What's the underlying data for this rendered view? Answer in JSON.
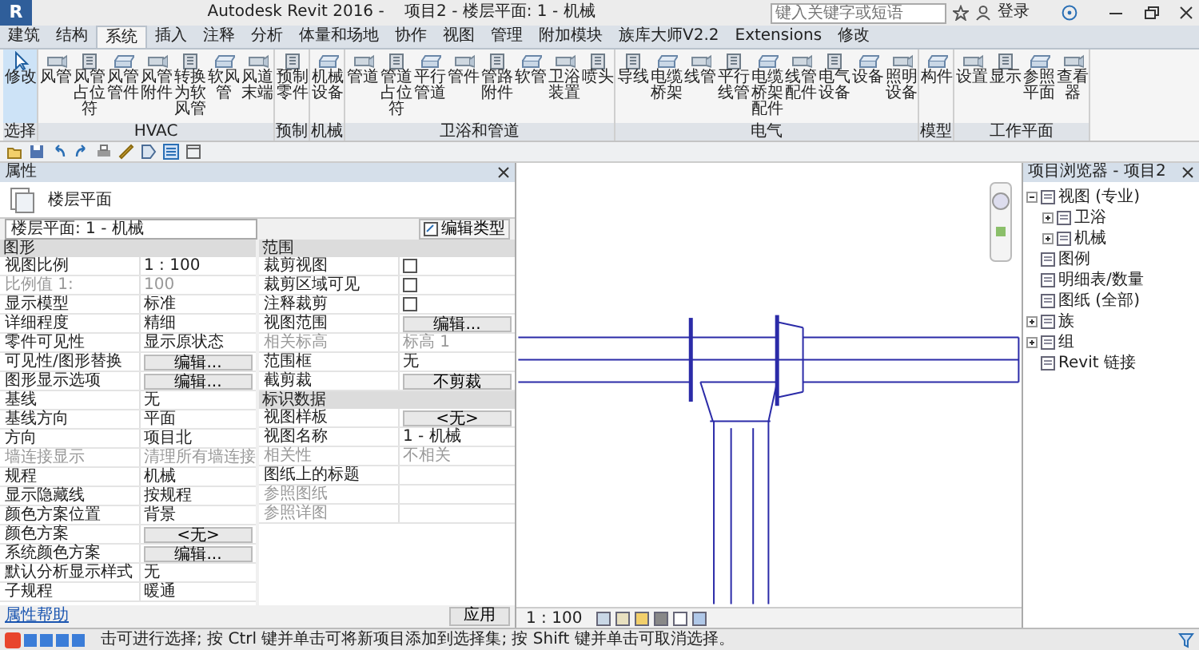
{
  "window": {
    "app_button": "R",
    "title": "Autodesk Revit 2016 -    项目2 - 楼层平面: 1 - 机械",
    "search": {
      "placeholder": "键入关键字或短语"
    },
    "sign_in": "登录"
  },
  "tabs": [
    {
      "label": "建筑",
      "selected": false
    },
    {
      "label": "结构",
      "selected": false
    },
    {
      "label": "系统",
      "selected": true
    },
    {
      "label": "插入",
      "selected": false
    },
    {
      "label": "注释",
      "selected": false
    },
    {
      "label": "分析",
      "selected": false
    },
    {
      "label": "体量和场地",
      "selected": false
    },
    {
      "label": "协作",
      "selected": false
    },
    {
      "label": "视图",
      "selected": false
    },
    {
      "label": "管理",
      "selected": false
    },
    {
      "label": "附加模块",
      "selected": false
    },
    {
      "label": "族库大师V2.2",
      "selected": false
    },
    {
      "label": "Extensions",
      "selected": false
    },
    {
      "label": "修改",
      "selected": false
    }
  ],
  "ribbon": {
    "panels": [
      {
        "label": "选择",
        "buttons": [
          "修改"
        ]
      },
      {
        "label": "HVAC",
        "buttons": [
          "风管",
          "风管占位符",
          "风管管件",
          "风管附件",
          "转换为软风管",
          "软风管",
          "风道末端"
        ]
      },
      {
        "label": "预制",
        "buttons": [
          "预制零件"
        ]
      },
      {
        "label": "机械",
        "buttons": [
          "机械设备"
        ]
      },
      {
        "label": "卫浴和管道",
        "buttons": [
          "管道",
          "管道占位符",
          "平行管道",
          "管件",
          "管路附件",
          "软管",
          "卫浴装置",
          "喷头"
        ]
      },
      {
        "label": "电气",
        "buttons": [
          "导线",
          "电缆桥架",
          "线管",
          "平行线管",
          "电缆桥架配件",
          "线管配件",
          "电气设备",
          "设备",
          "照明设备"
        ]
      },
      {
        "label": "模型",
        "buttons": [
          "构件"
        ]
      },
      {
        "label": "工作平面",
        "buttons": [
          "设置",
          "显示",
          "参照平面",
          "查看器"
        ]
      }
    ]
  },
  "properties": {
    "title": "属性",
    "type_name": "楼层平面",
    "instance": "楼层平面: 1 - 机械",
    "edit_type": "编辑类型",
    "groups": [
      {
        "name": "图形",
        "rows": [
          {
            "label": "视图比例",
            "kind": "text",
            "value": "1 : 100",
            "disabled": false
          },
          {
            "label": "比例值 1:",
            "kind": "text",
            "value": "100",
            "disabled": true
          },
          {
            "label": "显示模型",
            "kind": "text",
            "value": "标准",
            "disabled": false
          },
          {
            "label": "详细程度",
            "kind": "text",
            "value": "精细",
            "disabled": false
          },
          {
            "label": "零件可见性",
            "kind": "text",
            "value": "显示原状态",
            "disabled": false
          },
          {
            "label": "可见性/图形替换",
            "kind": "button",
            "value": "编辑...",
            "disabled": false
          },
          {
            "label": "图形显示选项",
            "kind": "button",
            "value": "编辑...",
            "disabled": false
          },
          {
            "label": "基线",
            "kind": "text",
            "value": "无",
            "disabled": false
          },
          {
            "label": "基线方向",
            "kind": "text",
            "value": "平面",
            "disabled": false
          },
          {
            "label": "方向",
            "kind": "text",
            "value": "项目北",
            "disabled": false
          },
          {
            "label": "墙连接显示",
            "kind": "text",
            "value": "清理所有墙连接",
            "disabled": true
          },
          {
            "label": "规程",
            "kind": "text",
            "value": "机械",
            "disabled": false
          },
          {
            "label": "显示隐藏线",
            "kind": "text",
            "value": "按规程",
            "disabled": false
          },
          {
            "label": "颜色方案位置",
            "kind": "text",
            "value": "背景",
            "disabled": false
          },
          {
            "label": "颜色方案",
            "kind": "button",
            "value": "<无>",
            "disabled": false
          },
          {
            "label": "系统颜色方案",
            "kind": "button",
            "value": "编辑...",
            "disabled": false
          },
          {
            "label": "默认分析显示样式",
            "kind": "text",
            "value": "无",
            "disabled": false
          },
          {
            "label": "子规程",
            "kind": "text",
            "value": "暖通",
            "disabled": false
          }
        ]
      },
      {
        "name": "范围",
        "rows": [
          {
            "label": "裁剪视图",
            "kind": "checkbox",
            "checked": false,
            "disabled": false
          },
          {
            "label": "裁剪区域可见",
            "kind": "checkbox",
            "checked": false,
            "disabled": false
          },
          {
            "label": "注释裁剪",
            "kind": "checkbox",
            "checked": false,
            "disabled": false
          },
          {
            "label": "视图范围",
            "kind": "button",
            "value": "编辑...",
            "disabled": false
          },
          {
            "label": "相关标高",
            "kind": "text",
            "value": "标高 1",
            "disabled": true
          },
          {
            "label": "范围框",
            "kind": "text",
            "value": "无",
            "disabled": false
          },
          {
            "label": "截剪裁",
            "kind": "button",
            "value": "不剪裁",
            "disabled": false
          }
        ]
      },
      {
        "name": "标识数据",
        "rows": [
          {
            "label": "视图样板",
            "kind": "button",
            "value": "<无>",
            "disabled": false
          },
          {
            "label": "视图名称",
            "kind": "text",
            "value": "1 - 机械",
            "disabled": false
          },
          {
            "label": "相关性",
            "kind": "text",
            "value": "不相关",
            "disabled": true
          },
          {
            "label": "图纸上的标题",
            "kind": "text",
            "value": "",
            "disabled": false
          },
          {
            "label": "参照图纸",
            "kind": "text",
            "value": "",
            "disabled": true
          },
          {
            "label": "参照详图",
            "kind": "text",
            "value": "",
            "disabled": true
          }
        ]
      }
    ],
    "help": "属性帮助",
    "apply": "应用"
  },
  "view_bar": {
    "scale": "1 : 100"
  },
  "browser": {
    "title": "项目浏览器 - 项目2",
    "tree": [
      {
        "label": "视图 (专业)",
        "expanded": true,
        "children": [
          {
            "label": "卫浴",
            "expanded": false
          },
          {
            "label": "机械",
            "expanded": false
          }
        ]
      },
      {
        "label": "图例"
      },
      {
        "label": "明细表/数量"
      },
      {
        "label": "图纸 (全部)"
      },
      {
        "label": "族",
        "expanded": false
      },
      {
        "label": "组",
        "expanded": false
      },
      {
        "label": "Revit 链接"
      }
    ]
  },
  "status_bar": {
    "message": "击可进行选择; 按 Ctrl 键并单击可将新项目添加到选择集; 按 Shift 键并单击可取消选择。"
  }
}
